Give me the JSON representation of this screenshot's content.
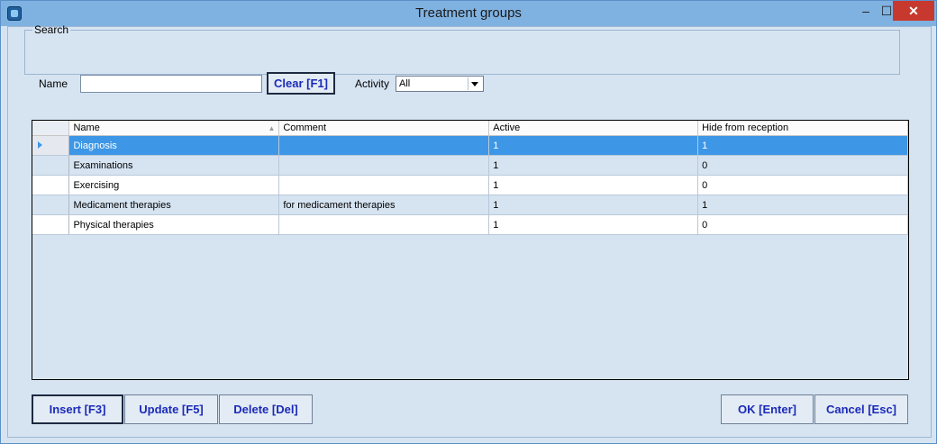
{
  "window": {
    "title": "Treatment groups",
    "min_glyph": "–",
    "max_glyph": "☐",
    "close_glyph": "✕"
  },
  "search": {
    "legend": "Search",
    "name_label": "Name",
    "name_value": "",
    "clear_button": "Clear [F1]",
    "activity_label": "Activity",
    "activity_value": "All"
  },
  "grid": {
    "columns": [
      "Name",
      "Comment",
      "Active",
      "Hide from reception"
    ],
    "rows": [
      {
        "name": "Diagnosis",
        "comment": "",
        "active": "1",
        "hide": "1",
        "selected": true
      },
      {
        "name": "Examinations",
        "comment": "",
        "active": "1",
        "hide": "0"
      },
      {
        "name": "Exercising",
        "comment": "",
        "active": "1",
        "hide": "0"
      },
      {
        "name": "Medicament therapies",
        "comment": "for medicament therapies",
        "active": "1",
        "hide": "1"
      },
      {
        "name": "Physical therapies",
        "comment": "",
        "active": "1",
        "hide": "0"
      }
    ]
  },
  "buttons": {
    "insert": "Insert [F3]",
    "update": "Update [F5]",
    "delete": "Delete [Del]",
    "ok": "OK [Enter]",
    "cancel": "Cancel [Esc]"
  },
  "colors": {
    "selection": "#3d97e6",
    "button_text": "#1b2bb8",
    "background": "#d6e4f2"
  }
}
